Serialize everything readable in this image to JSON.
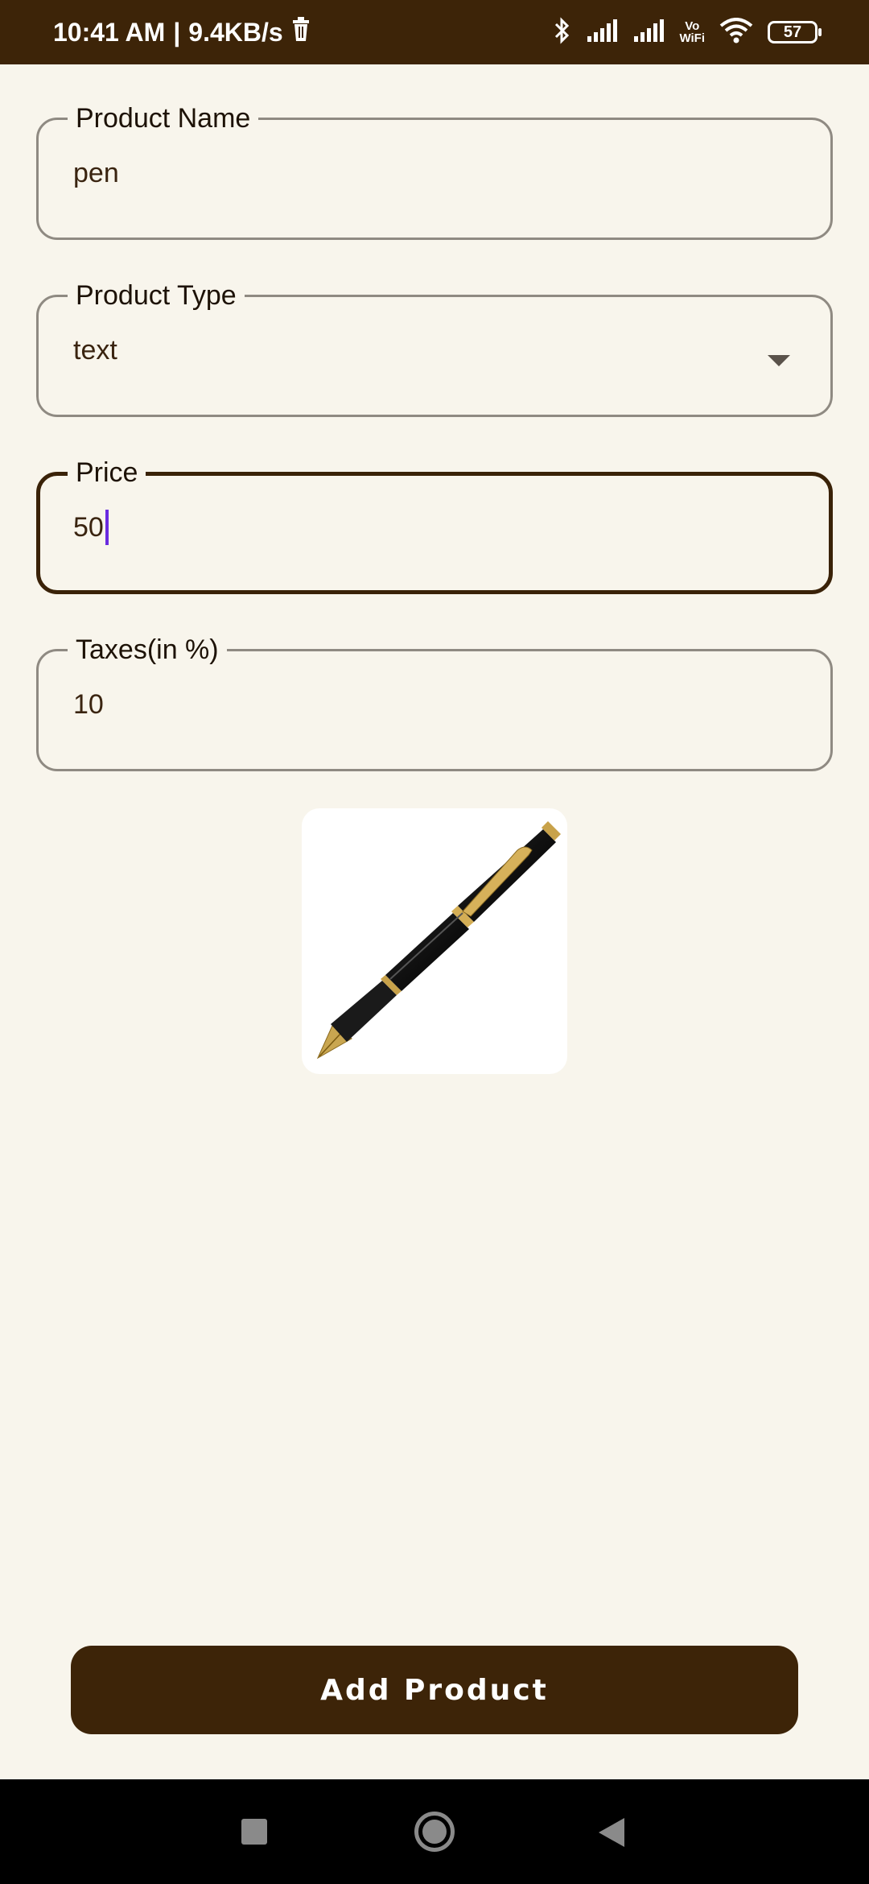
{
  "status_bar": {
    "time": "10:41 AM",
    "separator": "|",
    "net_speed": "9.4KB/s",
    "vowifi_top": "Vo",
    "vowifi_bottom": "WiFi",
    "battery": "57",
    "icons": [
      "delete-icon",
      "bluetooth-icon",
      "signal-icon",
      "signal-icon",
      "vowifi-icon",
      "wifi-icon",
      "battery-icon"
    ]
  },
  "form": {
    "product_name": {
      "label": "Product Name",
      "value": "pen"
    },
    "product_type": {
      "label": "Product Type",
      "value": "text"
    },
    "price": {
      "label": "Price",
      "value": "50"
    },
    "taxes": {
      "label": "Taxes(in %)",
      "value": "10"
    }
  },
  "image": {
    "icon": "fountain-pen"
  },
  "actions": {
    "add_product_label": "Add Product"
  },
  "colors": {
    "primary": "#3d2408",
    "background": "#f8f5ec",
    "caret": "#6a2be0",
    "outline": "#8f8a82"
  }
}
